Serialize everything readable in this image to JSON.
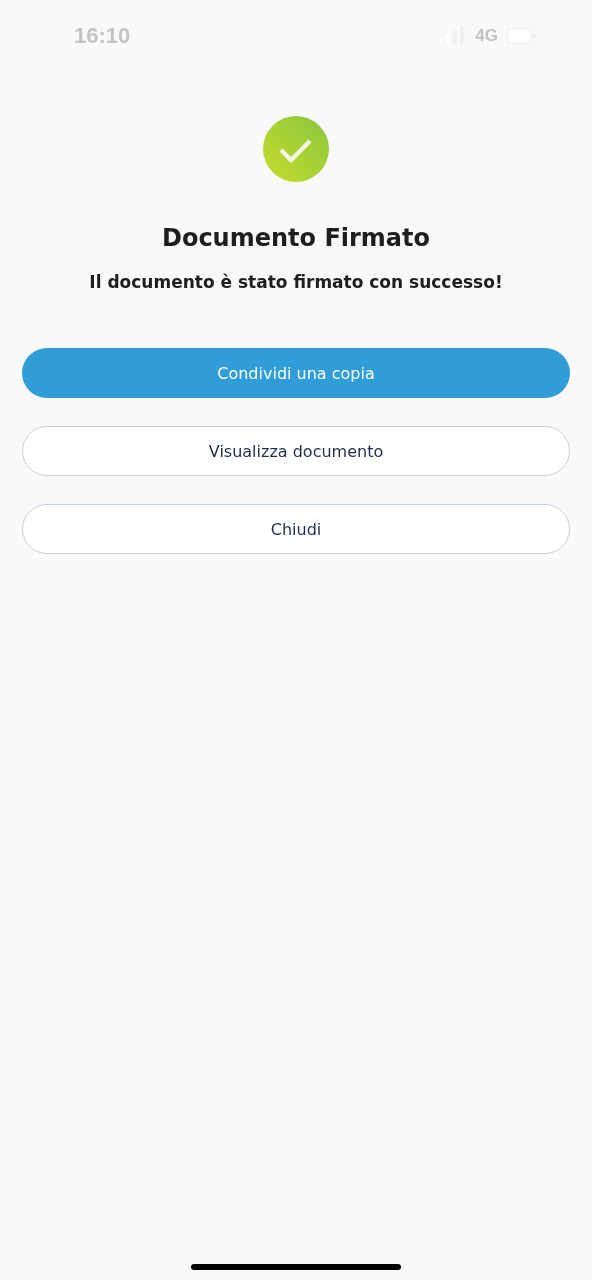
{
  "status_bar": {
    "time": "16:10",
    "network": "4G"
  },
  "title": "Documento Firmato",
  "message": "Il documento è stato firmato con successo!",
  "buttons": [
    {
      "label": "Condividi una copia",
      "kind": "primary"
    },
    {
      "label": "Visualizza documento",
      "kind": "outline"
    },
    {
      "label": "Chiudi",
      "kind": "outline"
    }
  ]
}
